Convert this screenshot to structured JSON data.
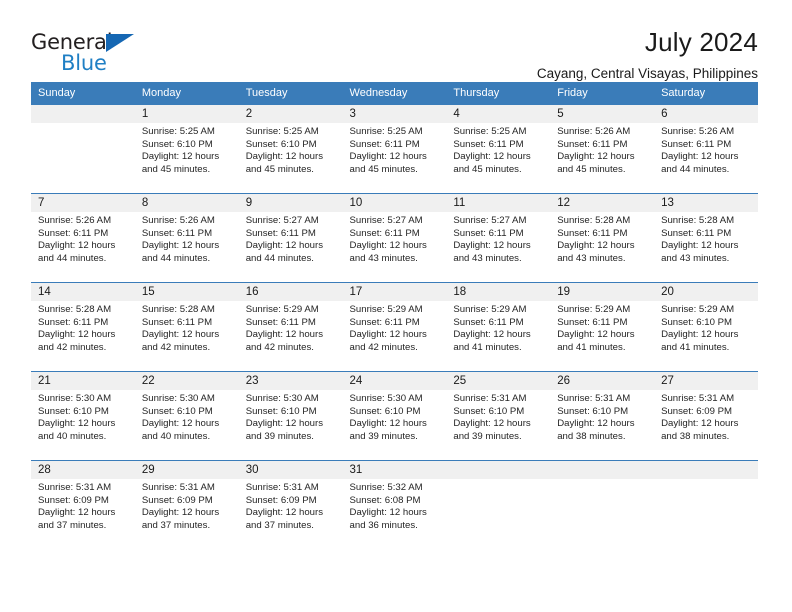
{
  "brand": {
    "line1": "General",
    "line2": "Blue",
    "logo_icon": "blue-triangle-logo",
    "accent_color": "#1f7fc4"
  },
  "header": {
    "title": "July 2024",
    "subtitle": "Cayang, Central Visayas, Philippines"
  },
  "calendar": {
    "header_bg": "#3a7cb9",
    "daynum_bg": "#f0f0f0",
    "weekday_headers": [
      "Sunday",
      "Monday",
      "Tuesday",
      "Wednesday",
      "Thursday",
      "Friday",
      "Saturday"
    ],
    "weeks": [
      [
        {
          "day": "",
          "sunrise": "",
          "sunset": "",
          "daylight": "",
          "daylight2": "",
          "empty": true
        },
        {
          "day": "1",
          "sunrise": "Sunrise: 5:25 AM",
          "sunset": "Sunset: 6:10 PM",
          "daylight": "Daylight: 12 hours",
          "daylight2": "and 45 minutes."
        },
        {
          "day": "2",
          "sunrise": "Sunrise: 5:25 AM",
          "sunset": "Sunset: 6:10 PM",
          "daylight": "Daylight: 12 hours",
          "daylight2": "and 45 minutes."
        },
        {
          "day": "3",
          "sunrise": "Sunrise: 5:25 AM",
          "sunset": "Sunset: 6:11 PM",
          "daylight": "Daylight: 12 hours",
          "daylight2": "and 45 minutes."
        },
        {
          "day": "4",
          "sunrise": "Sunrise: 5:25 AM",
          "sunset": "Sunset: 6:11 PM",
          "daylight": "Daylight: 12 hours",
          "daylight2": "and 45 minutes."
        },
        {
          "day": "5",
          "sunrise": "Sunrise: 5:26 AM",
          "sunset": "Sunset: 6:11 PM",
          "daylight": "Daylight: 12 hours",
          "daylight2": "and 45 minutes."
        },
        {
          "day": "6",
          "sunrise": "Sunrise: 5:26 AM",
          "sunset": "Sunset: 6:11 PM",
          "daylight": "Daylight: 12 hours",
          "daylight2": "and 44 minutes."
        }
      ],
      [
        {
          "day": "7",
          "sunrise": "Sunrise: 5:26 AM",
          "sunset": "Sunset: 6:11 PM",
          "daylight": "Daylight: 12 hours",
          "daylight2": "and 44 minutes."
        },
        {
          "day": "8",
          "sunrise": "Sunrise: 5:26 AM",
          "sunset": "Sunset: 6:11 PM",
          "daylight": "Daylight: 12 hours",
          "daylight2": "and 44 minutes."
        },
        {
          "day": "9",
          "sunrise": "Sunrise: 5:27 AM",
          "sunset": "Sunset: 6:11 PM",
          "daylight": "Daylight: 12 hours",
          "daylight2": "and 44 minutes."
        },
        {
          "day": "10",
          "sunrise": "Sunrise: 5:27 AM",
          "sunset": "Sunset: 6:11 PM",
          "daylight": "Daylight: 12 hours",
          "daylight2": "and 43 minutes."
        },
        {
          "day": "11",
          "sunrise": "Sunrise: 5:27 AM",
          "sunset": "Sunset: 6:11 PM",
          "daylight": "Daylight: 12 hours",
          "daylight2": "and 43 minutes."
        },
        {
          "day": "12",
          "sunrise": "Sunrise: 5:28 AM",
          "sunset": "Sunset: 6:11 PM",
          "daylight": "Daylight: 12 hours",
          "daylight2": "and 43 minutes."
        },
        {
          "day": "13",
          "sunrise": "Sunrise: 5:28 AM",
          "sunset": "Sunset: 6:11 PM",
          "daylight": "Daylight: 12 hours",
          "daylight2": "and 43 minutes."
        }
      ],
      [
        {
          "day": "14",
          "sunrise": "Sunrise: 5:28 AM",
          "sunset": "Sunset: 6:11 PM",
          "daylight": "Daylight: 12 hours",
          "daylight2": "and 42 minutes."
        },
        {
          "day": "15",
          "sunrise": "Sunrise: 5:28 AM",
          "sunset": "Sunset: 6:11 PM",
          "daylight": "Daylight: 12 hours",
          "daylight2": "and 42 minutes."
        },
        {
          "day": "16",
          "sunrise": "Sunrise: 5:29 AM",
          "sunset": "Sunset: 6:11 PM",
          "daylight": "Daylight: 12 hours",
          "daylight2": "and 42 minutes."
        },
        {
          "day": "17",
          "sunrise": "Sunrise: 5:29 AM",
          "sunset": "Sunset: 6:11 PM",
          "daylight": "Daylight: 12 hours",
          "daylight2": "and 42 minutes."
        },
        {
          "day": "18",
          "sunrise": "Sunrise: 5:29 AM",
          "sunset": "Sunset: 6:11 PM",
          "daylight": "Daylight: 12 hours",
          "daylight2": "and 41 minutes."
        },
        {
          "day": "19",
          "sunrise": "Sunrise: 5:29 AM",
          "sunset": "Sunset: 6:11 PM",
          "daylight": "Daylight: 12 hours",
          "daylight2": "and 41 minutes."
        },
        {
          "day": "20",
          "sunrise": "Sunrise: 5:29 AM",
          "sunset": "Sunset: 6:10 PM",
          "daylight": "Daylight: 12 hours",
          "daylight2": "and 41 minutes."
        }
      ],
      [
        {
          "day": "21",
          "sunrise": "Sunrise: 5:30 AM",
          "sunset": "Sunset: 6:10 PM",
          "daylight": "Daylight: 12 hours",
          "daylight2": "and 40 minutes."
        },
        {
          "day": "22",
          "sunrise": "Sunrise: 5:30 AM",
          "sunset": "Sunset: 6:10 PM",
          "daylight": "Daylight: 12 hours",
          "daylight2": "and 40 minutes."
        },
        {
          "day": "23",
          "sunrise": "Sunrise: 5:30 AM",
          "sunset": "Sunset: 6:10 PM",
          "daylight": "Daylight: 12 hours",
          "daylight2": "and 39 minutes."
        },
        {
          "day": "24",
          "sunrise": "Sunrise: 5:30 AM",
          "sunset": "Sunset: 6:10 PM",
          "daylight": "Daylight: 12 hours",
          "daylight2": "and 39 minutes."
        },
        {
          "day": "25",
          "sunrise": "Sunrise: 5:31 AM",
          "sunset": "Sunset: 6:10 PM",
          "daylight": "Daylight: 12 hours",
          "daylight2": "and 39 minutes."
        },
        {
          "day": "26",
          "sunrise": "Sunrise: 5:31 AM",
          "sunset": "Sunset: 6:10 PM",
          "daylight": "Daylight: 12 hours",
          "daylight2": "and 38 minutes."
        },
        {
          "day": "27",
          "sunrise": "Sunrise: 5:31 AM",
          "sunset": "Sunset: 6:09 PM",
          "daylight": "Daylight: 12 hours",
          "daylight2": "and 38 minutes."
        }
      ],
      [
        {
          "day": "28",
          "sunrise": "Sunrise: 5:31 AM",
          "sunset": "Sunset: 6:09 PM",
          "daylight": "Daylight: 12 hours",
          "daylight2": "and 37 minutes."
        },
        {
          "day": "29",
          "sunrise": "Sunrise: 5:31 AM",
          "sunset": "Sunset: 6:09 PM",
          "daylight": "Daylight: 12 hours",
          "daylight2": "and 37 minutes."
        },
        {
          "day": "30",
          "sunrise": "Sunrise: 5:31 AM",
          "sunset": "Sunset: 6:09 PM",
          "daylight": "Daylight: 12 hours",
          "daylight2": "and 37 minutes."
        },
        {
          "day": "31",
          "sunrise": "Sunrise: 5:32 AM",
          "sunset": "Sunset: 6:08 PM",
          "daylight": "Daylight: 12 hours",
          "daylight2": "and 36 minutes."
        },
        {
          "day": "",
          "sunrise": "",
          "sunset": "",
          "daylight": "",
          "daylight2": "",
          "empty": true
        },
        {
          "day": "",
          "sunrise": "",
          "sunset": "",
          "daylight": "",
          "daylight2": "",
          "empty": true
        },
        {
          "day": "",
          "sunrise": "",
          "sunset": "",
          "daylight": "",
          "daylight2": "",
          "empty": true
        }
      ]
    ]
  }
}
